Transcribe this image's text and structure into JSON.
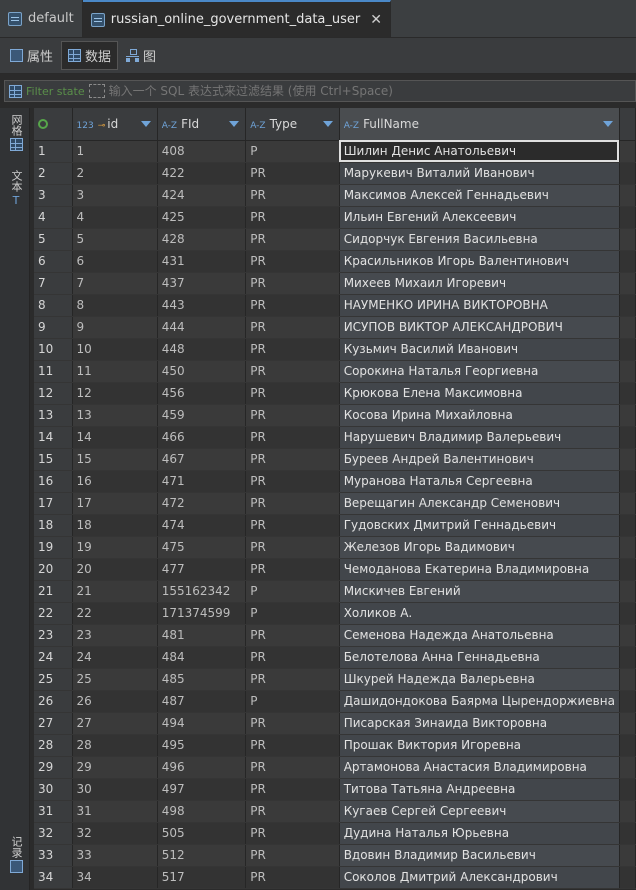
{
  "tabs": [
    {
      "label": "default",
      "active": false
    },
    {
      "label": "russian_online_government_data_user",
      "active": true
    }
  ],
  "subtabs": [
    {
      "label": "属性",
      "icon": "properties-icon"
    },
    {
      "label": "数据",
      "icon": "grid-icon"
    },
    {
      "label": "图",
      "icon": "diagram-icon"
    }
  ],
  "filter": {
    "label": "Filter state",
    "placeholder": "输入一个 SQL 表达式来过滤结果 (使用 Ctrl+Space)"
  },
  "side": {
    "grid": "网格",
    "text": "文本",
    "record": "记录"
  },
  "columns": [
    {
      "type": "123",
      "name": "id"
    },
    {
      "type": "A-Z",
      "name": "FId"
    },
    {
      "type": "A-Z",
      "name": "Type"
    },
    {
      "type": "A-Z",
      "name": "FullName"
    }
  ],
  "rows": [
    [
      "1",
      "1",
      "408",
      "P",
      "Шилин Денис Анатольевич"
    ],
    [
      "2",
      "2",
      "422",
      "PR",
      "Марукевич Виталий Иванович"
    ],
    [
      "3",
      "3",
      "424",
      "PR",
      "Максимов Алексей Геннадьевич"
    ],
    [
      "4",
      "4",
      "425",
      "PR",
      "Ильин Евгений Алексеевич"
    ],
    [
      "5",
      "5",
      "428",
      "PR",
      "Сидорчук Евгения Васильевна"
    ],
    [
      "6",
      "6",
      "431",
      "PR",
      "Красильников Игорь Валентинович"
    ],
    [
      "7",
      "7",
      "437",
      "PR",
      "Михеев Михаил Игоревич"
    ],
    [
      "8",
      "8",
      "443",
      "PR",
      "НАУМЕНКО ИРИНА ВИКТОРОВНА"
    ],
    [
      "9",
      "9",
      "444",
      "PR",
      "ИСУПОВ ВИКТОР АЛЕКСАНДРОВИЧ"
    ],
    [
      "10",
      "10",
      "448",
      "PR",
      "Кузьмич Василий Иванович"
    ],
    [
      "11",
      "11",
      "450",
      "PR",
      "Сорокина Наталья Георгиевна"
    ],
    [
      "12",
      "12",
      "456",
      "PR",
      "Крюкова Елена Максимовна"
    ],
    [
      "13",
      "13",
      "459",
      "PR",
      "Косова Ирина Михайловна"
    ],
    [
      "14",
      "14",
      "466",
      "PR",
      "Нарушевич Владимир Валерьевич"
    ],
    [
      "15",
      "15",
      "467",
      "PR",
      "Буреев Андрей Валентинович"
    ],
    [
      "16",
      "16",
      "471",
      "PR",
      "Муранова Наталья Сергеевна"
    ],
    [
      "17",
      "17",
      "472",
      "PR",
      "Верещагин Александр Семенович"
    ],
    [
      "18",
      "18",
      "474",
      "PR",
      "Гудовских Дмитрий Геннадьевич"
    ],
    [
      "19",
      "19",
      "475",
      "PR",
      "Железов Игорь Вадимович"
    ],
    [
      "20",
      "20",
      "477",
      "PR",
      "Чемоданова Екатерина Владимировна"
    ],
    [
      "21",
      "21",
      "155162342",
      "P",
      "Мискичев Евгений"
    ],
    [
      "22",
      "22",
      "171374599",
      "P",
      "Холиков А."
    ],
    [
      "23",
      "23",
      "481",
      "PR",
      "Семенова Надежда Анатольевна"
    ],
    [
      "24",
      "24",
      "484",
      "PR",
      "Белотелова Анна Геннадьевна"
    ],
    [
      "25",
      "25",
      "485",
      "PR",
      "Шкурей Надежда Валерьевна"
    ],
    [
      "26",
      "26",
      "487",
      "P",
      "Дашидондокова Баярма Цырендоржиевна"
    ],
    [
      "27",
      "27",
      "494",
      "PR",
      "Писарская Зинаида Викторовна"
    ],
    [
      "28",
      "28",
      "495",
      "PR",
      "Прошак Виктория Игоревна"
    ],
    [
      "29",
      "29",
      "496",
      "PR",
      "Артамонова Анастасия Владимировна"
    ],
    [
      "30",
      "30",
      "497",
      "PR",
      "Титова Татьяна Андреевна"
    ],
    [
      "31",
      "31",
      "498",
      "PR",
      "Кугаев Сергей Сергеевич"
    ],
    [
      "32",
      "32",
      "505",
      "PR",
      "Дудина Наталья Юрьевна"
    ],
    [
      "33",
      "33",
      "512",
      "PR",
      "Вдовин Владимир Васильевич"
    ],
    [
      "34",
      "34",
      "517",
      "PR",
      "Соколов Дмитрий Александрович"
    ]
  ]
}
